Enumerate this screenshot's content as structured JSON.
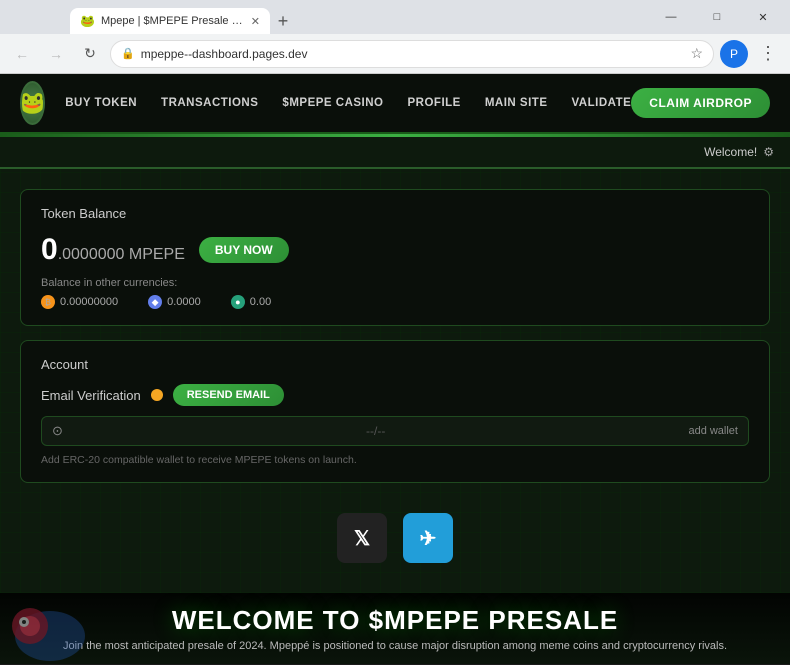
{
  "browser": {
    "tab_title": "Mpepe | $MPEPE Presale Live...",
    "tab_favicon": "🐸",
    "new_tab_icon": "+",
    "address": "mpeppe--dashboard.pages.dev",
    "address_scheme": "🔒",
    "window_controls": {
      "minimize": "—",
      "maximize": "□",
      "close": "✕"
    }
  },
  "nav": {
    "links": [
      {
        "label": "BUY TOKEN",
        "key": "buy-token"
      },
      {
        "label": "TRANSACTIONS",
        "key": "transactions"
      },
      {
        "label": "$MPEPE CASINO",
        "key": "casino"
      },
      {
        "label": "PROFILE",
        "key": "profile"
      },
      {
        "label": "MAIN SITE",
        "key": "main-site"
      },
      {
        "label": "VALIDATE",
        "key": "validate"
      }
    ],
    "cta_label": "CLAIM AIRDROP"
  },
  "welcome_bar": {
    "text": "Welcome!",
    "icon": "⚙"
  },
  "token_balance": {
    "section_title": "Token Balance",
    "integer_part": "0",
    "decimal_part": ".0000000 MPEPE",
    "buy_now_label": "BUY NOW",
    "other_currencies_label": "Balance in other currencies:",
    "currencies": [
      {
        "symbol": "₿",
        "color": "orange",
        "value": "0.00000000",
        "dot_class": "dot-orange"
      },
      {
        "symbol": "◆",
        "color": "blue",
        "value": "0.0000",
        "dot_class": "dot-blue"
      },
      {
        "symbol": "●",
        "color": "green",
        "value": "0.00",
        "dot_class": "dot-green"
      }
    ]
  },
  "account": {
    "section_title": "Account",
    "email_verification_label": "Email Verification",
    "resend_btn_label": "RESEND EMAIL",
    "wallet_separator": "--/--",
    "add_wallet_label": "add wallet",
    "wallet_hint": "Add ERC-20 compatible wallet to receive MPEPE tokens on launch."
  },
  "social": {
    "twitter_symbol": "𝕏",
    "telegram_symbol": "✈"
  },
  "promo": {
    "title": "WELCOME TO $MPEPE PRESALE",
    "subtitle": "Join the most anticipated presale of 2024. Mpeppé is positioned to cause major disruption among meme coins and cryptocurrency rivals."
  }
}
